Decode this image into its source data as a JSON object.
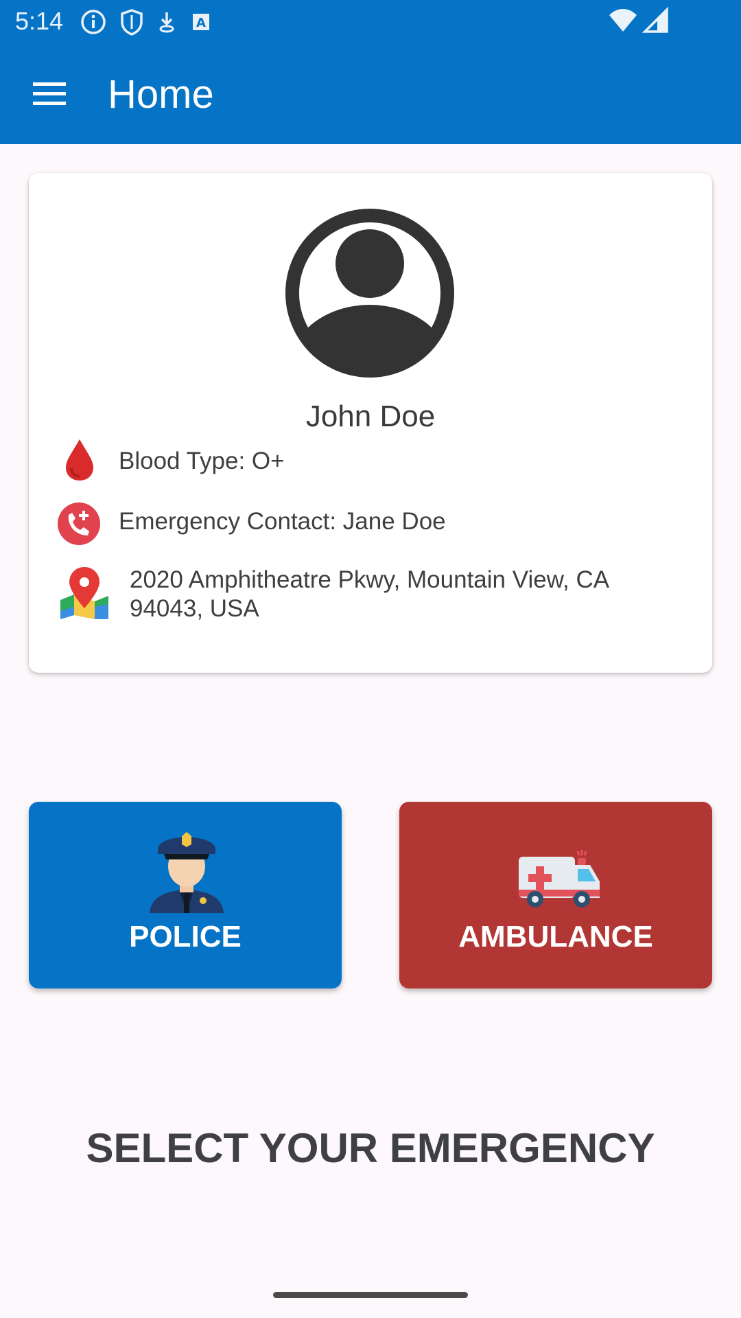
{
  "status_bar": {
    "time": "5:14",
    "icons": [
      "info-icon",
      "shield-icon",
      "download-icon",
      "text-a-icon",
      "wifi-icon",
      "signal-icon"
    ]
  },
  "app_bar": {
    "title": "Home",
    "menu_icon": "hamburger-menu-icon",
    "background": "#0674C6"
  },
  "profile": {
    "avatar_icon": "account-circle-icon",
    "name": "John Doe",
    "blood_type": "Blood Type: O+",
    "emergency_contact": "Emergency Contact: Jane Doe",
    "address_line1": "2020 Amphitheatre Pkwy, Mountain View, CA",
    "address_line2": "94043, USA"
  },
  "actions": {
    "police": {
      "label": "POLICE",
      "color": "#0674C6",
      "icon": "police-officer-icon"
    },
    "ambulance": {
      "label": "AMBULANCE",
      "color": "#B23633",
      "icon": "ambulance-icon"
    }
  },
  "prompt": "SELECT YOUR EMERGENCY"
}
